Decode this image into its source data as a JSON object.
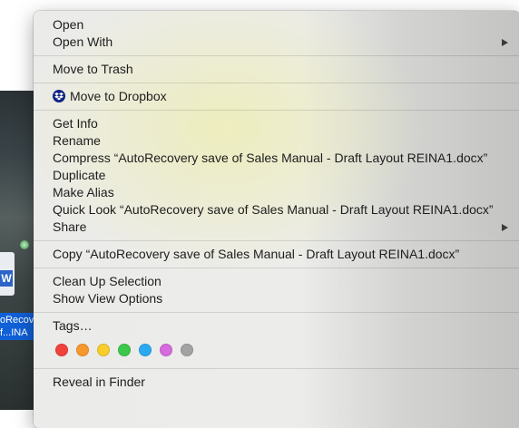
{
  "desktop": {
    "file_label_line1": "oRecov",
    "file_label_line2": "f...INA",
    "word_badge": "W"
  },
  "menu": {
    "groups": [
      [
        {
          "label": "Open",
          "submenu": false
        },
        {
          "label": "Open With",
          "submenu": true
        }
      ],
      [
        {
          "label": "Move to Trash",
          "submenu": false
        }
      ],
      [
        {
          "label": "Move to Dropbox",
          "submenu": false,
          "icon": "dropbox-icon"
        }
      ],
      [
        {
          "label": "Get Info",
          "submenu": false
        },
        {
          "label": "Rename",
          "submenu": false
        },
        {
          "label": "Compress “AutoRecovery save of Sales Manual - Draft Layout REINA1.docx”",
          "submenu": false
        },
        {
          "label": "Duplicate",
          "submenu": false
        },
        {
          "label": "Make Alias",
          "submenu": false
        },
        {
          "label": "Quick Look “AutoRecovery save of Sales Manual - Draft Layout REINA1.docx”",
          "submenu": false
        },
        {
          "label": "Share",
          "submenu": true
        }
      ],
      [
        {
          "label": "Copy “AutoRecovery save of Sales Manual - Draft Layout REINA1.docx”",
          "submenu": false
        }
      ],
      [
        {
          "label": "Clean Up Selection",
          "submenu": false
        },
        {
          "label": "Show View Options",
          "submenu": false
        }
      ],
      [
        {
          "label": "Tags…",
          "submenu": false
        }
      ],
      [
        {
          "label": "Reveal in Finder",
          "submenu": false
        }
      ]
    ],
    "tag_colors": [
      {
        "name": "red",
        "color": "#f2413d"
      },
      {
        "name": "orange",
        "color": "#f7982c"
      },
      {
        "name": "yellow",
        "color": "#f9cd2a"
      },
      {
        "name": "green",
        "color": "#3dc84b"
      },
      {
        "name": "blue",
        "color": "#2aa9f2"
      },
      {
        "name": "purple",
        "color": "#d56bdd"
      },
      {
        "name": "gray",
        "color": "#a3a3a3"
      }
    ]
  }
}
